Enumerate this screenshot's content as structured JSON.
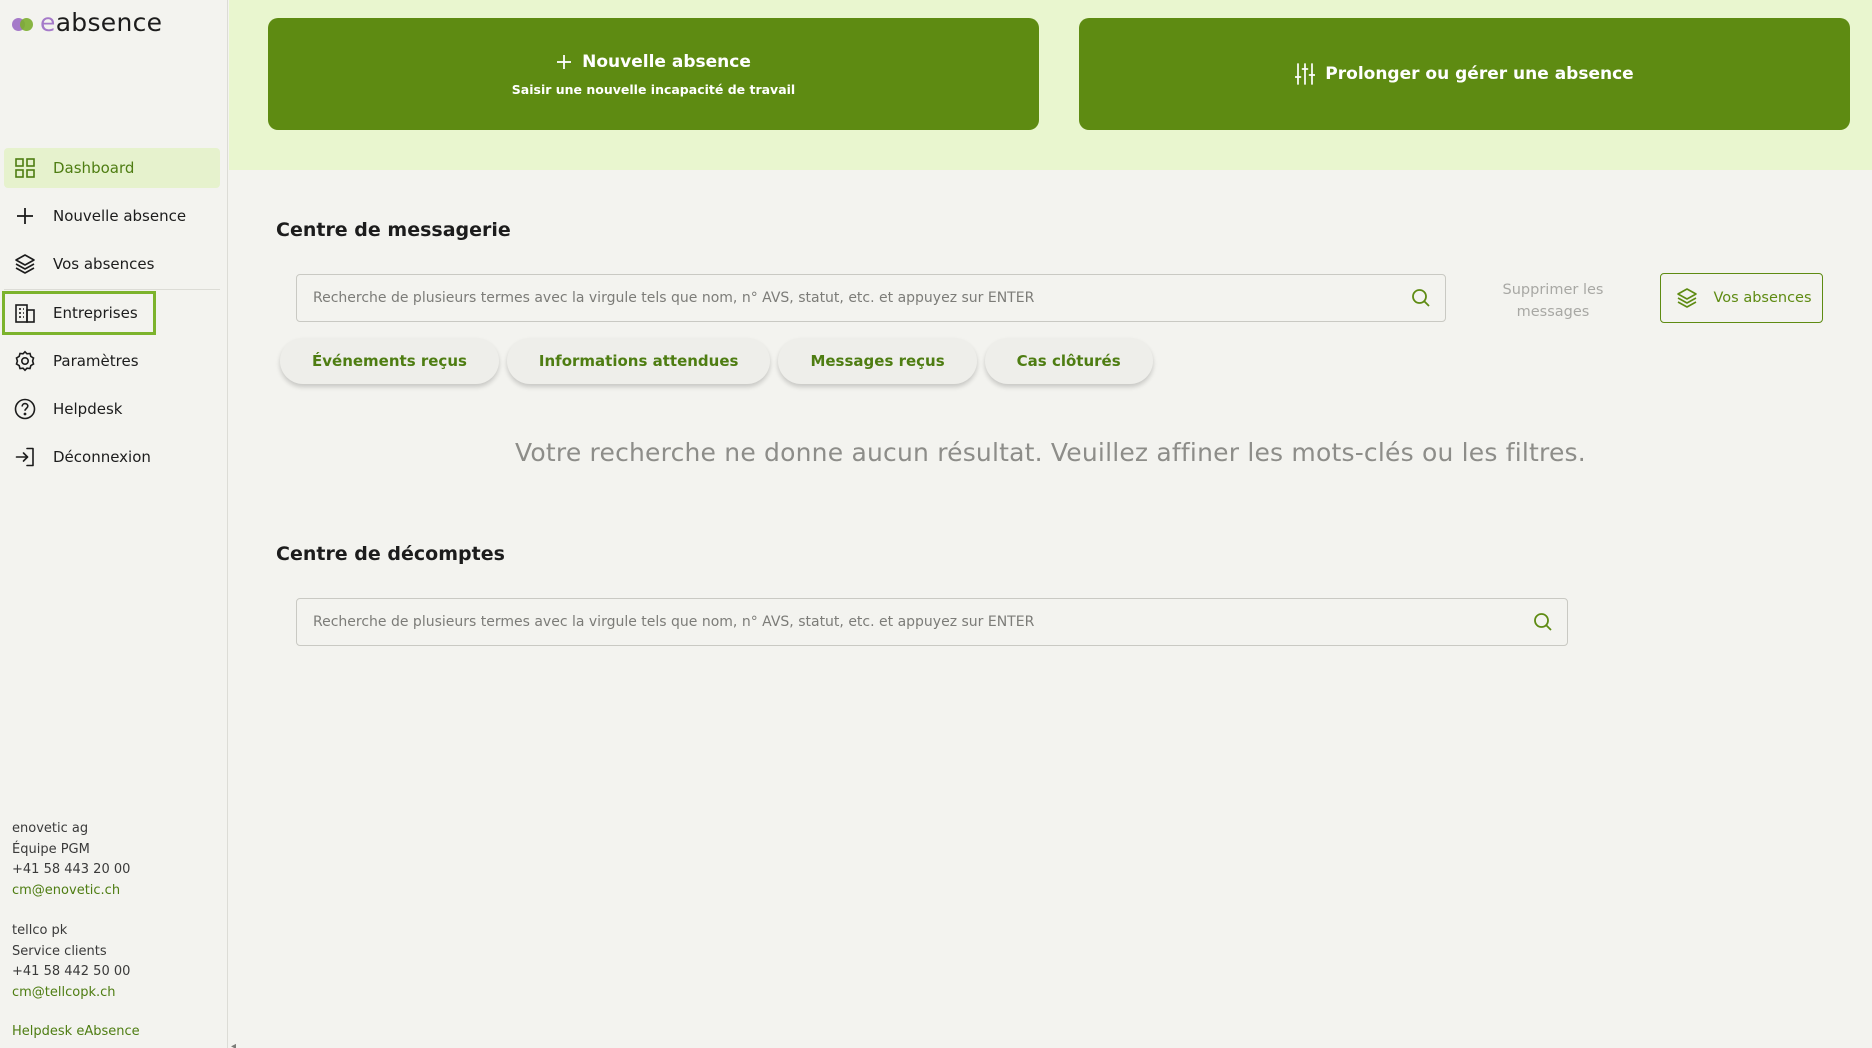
{
  "app": {
    "logo_prefix": "e",
    "logo_suffix": "absence"
  },
  "sidebar": {
    "items": [
      {
        "label": "Dashboard",
        "icon": "dashboard-grid-icon"
      },
      {
        "label": "Nouvelle absence",
        "icon": "plus-icon"
      },
      {
        "label": "Vos absences",
        "icon": "layers-icon"
      },
      {
        "label": "Entreprises",
        "icon": "building-icon"
      },
      {
        "label": "Paramètres",
        "icon": "gear-icon"
      },
      {
        "label": "Helpdesk",
        "icon": "question-circle-icon"
      },
      {
        "label": "Déconnexion",
        "icon": "logout-icon"
      }
    ],
    "contacts": [
      {
        "company": "enovetic ag",
        "team": "Équipe PGM",
        "phone": "+41 58 443 20 00",
        "email": "cm@enovetic.ch"
      },
      {
        "company": "tellco pk",
        "team": "Service clients",
        "phone": "+41 58 442 50 00",
        "email": "cm@tellcopk.ch"
      }
    ],
    "helpdesk_link": "Helpdesk eAbsence"
  },
  "top_actions": {
    "new_absence": {
      "title": "Nouvelle absence",
      "subtitle": "Saisir une nouvelle incapacité de travail"
    },
    "manage_absence": {
      "title": "Prolonger ou gérer une absence"
    }
  },
  "messaging": {
    "title": "Centre de messagerie",
    "search_placeholder": "Recherche de plusieurs termes avec la virgule tels que nom, n° AVS, statut, etc. et appuyez sur ENTER",
    "delete_label": "Supprimer les messages",
    "vos_absences_label": "Vos absences",
    "tabs": [
      "Événements reçus",
      "Informations attendues",
      "Messages reçus",
      "Cas clôturés"
    ],
    "empty_message": "Votre recherche ne donne aucun résultat. Veuillez affiner les mots-clés ou les filtres."
  },
  "statements": {
    "title": "Centre de décomptes",
    "search_placeholder": "Recherche de plusieurs termes avec la virgule tels que nom, n° AVS, statut, etc. et appuyez sur ENTER"
  },
  "colors": {
    "accent": "#5e8b12",
    "accent_light": "#e9f6cf",
    "highlight_outline": "#7cb32c"
  }
}
